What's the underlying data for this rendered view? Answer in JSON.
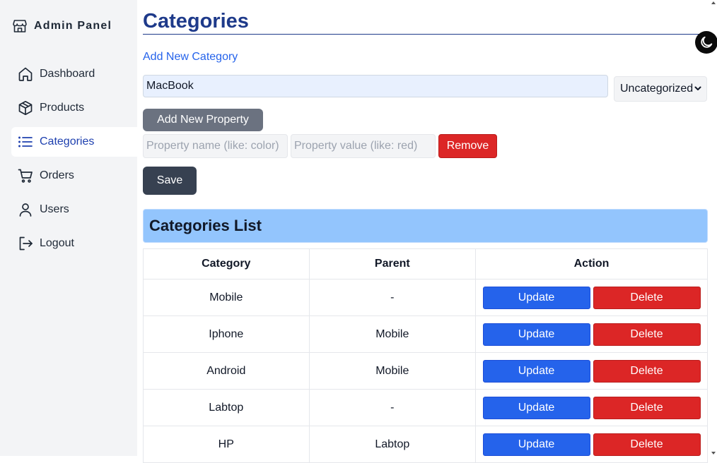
{
  "brand": {
    "title": "Admin Panel",
    "icon": "store-icon"
  },
  "sidebar": {
    "items": [
      {
        "label": "Dashboard",
        "icon": "home-icon",
        "active": false
      },
      {
        "label": "Products",
        "icon": "box-icon",
        "active": false
      },
      {
        "label": "Categories",
        "icon": "list-icon",
        "active": true
      },
      {
        "label": "Orders",
        "icon": "cart-icon",
        "active": false
      },
      {
        "label": "Users",
        "icon": "user-icon",
        "active": false
      },
      {
        "label": "Logout",
        "icon": "logout-icon",
        "active": false
      }
    ]
  },
  "main": {
    "title": "Categories",
    "theme_toggle_icon": "moon-icon",
    "form": {
      "heading": "Add New Category",
      "name_value": "MacBook",
      "parent_selected": "Uncategorized",
      "add_property_label": "Add New Property",
      "property_name_placeholder": "Property name (like: color)",
      "property_value_placeholder": "Property value (like: red)",
      "remove_label": "Remove",
      "save_label": "Save"
    },
    "list": {
      "heading": "Categories List",
      "columns": [
        "Category",
        "Parent",
        "Action"
      ],
      "rows": [
        {
          "category": "Mobile",
          "parent": "-"
        },
        {
          "category": "Iphone",
          "parent": "Mobile"
        },
        {
          "category": "Android",
          "parent": "Mobile"
        },
        {
          "category": "Labtop",
          "parent": "-"
        },
        {
          "category": "HP",
          "parent": "Labtop"
        }
      ],
      "update_label": "Update",
      "delete_label": "Delete"
    }
  },
  "colors": {
    "accent": "#2563eb",
    "title": "#1e3a8a",
    "danger": "#dc2626",
    "list_header": "#93c5fd",
    "save": "#374151"
  }
}
